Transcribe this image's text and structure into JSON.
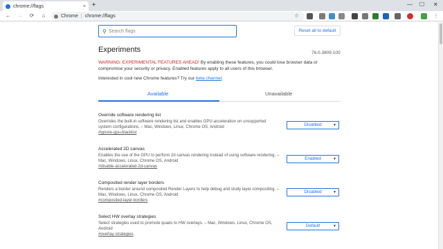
{
  "tab": {
    "title": "chrome://flags",
    "close": "×",
    "new_tab": "+"
  },
  "window": {
    "minimize": "—",
    "maximize": "☐",
    "close": "✕"
  },
  "omnibox": {
    "chip": "Chrome",
    "separator": "|",
    "url": "chrome://flags"
  },
  "search": {
    "placeholder": "Search flags"
  },
  "reset_label": "Reset all to default",
  "headline": "Experiments",
  "version": "76.0.3809.100",
  "warning": {
    "strong": "WARNING: EXPERIMENTAL FEATURES AHEAD!",
    "rest": " By enabling these features, you could lose browser data or compromise your security or privacy. Enabled features apply to all users of this browser."
  },
  "interest": {
    "text": "Interested in cool new Chrome features? Try our ",
    "link": "beta channel",
    "end": "."
  },
  "tabs": {
    "available": "Available",
    "unavailable": "Unavailable"
  },
  "flags": [
    {
      "name": "Override software rendering list",
      "desc": "Overrides the built-in software rendering list and enables GPU-acceleration on unsupported system configurations. – Mac, Windows, Linux, Chrome OS, Android",
      "id": "#ignore-gpu-blacklist",
      "value": "Disabled"
    },
    {
      "name": "Accelerated 2D canvas",
      "desc": "Enables the use of the GPU to perform 2d canvas rendering instead of using software rendering. – Mac, Windows, Linux, Chrome OS, Android",
      "id": "#disable-accelerated-2d-canvas",
      "value": "Enabled"
    },
    {
      "name": "Composited render layer borders",
      "desc": "Renders a border around composited Render Layers to help debug and study layer compositing. – Mac, Windows, Linux, Chrome OS, Android",
      "id": "#composited-layer-borders",
      "value": "Disabled"
    },
    {
      "name": "Select HW overlay strategies",
      "desc": "Select strategies used to promote quads to HW overlays. – Mac, Windows, Linux, Chrome OS, Android",
      "id": "#overlay-strategies",
      "value": "Default"
    }
  ],
  "colors": {
    "accent": "#1a73e8",
    "warning": "#c5221f"
  }
}
